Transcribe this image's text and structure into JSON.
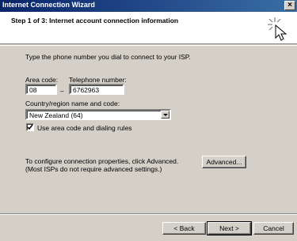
{
  "window": {
    "title": "Internet Connection Wizard",
    "close_label": "×"
  },
  "header": {
    "step_title": "Step 1 of 3: Internet account connection information"
  },
  "instructions": "Type the phone number you dial to connect to your ISP.",
  "form": {
    "area_code": {
      "label": "Area code:",
      "value": "08"
    },
    "separator": "–",
    "telephone": {
      "label": "Telephone number:",
      "value": "6762963"
    },
    "country": {
      "label": "Country/region name and code:",
      "value": "New Zealand (64)"
    },
    "use_area_code": {
      "label": "Use area code and dialing rules",
      "checked": true
    }
  },
  "advanced_info": {
    "line1": "To configure connection properties, click Advanced.",
    "line2": "(Most ISPs do not require advanced settings.)"
  },
  "buttons": {
    "advanced": "Advanced...",
    "back": "< Back",
    "next": "Next >",
    "cancel": "Cancel"
  }
}
